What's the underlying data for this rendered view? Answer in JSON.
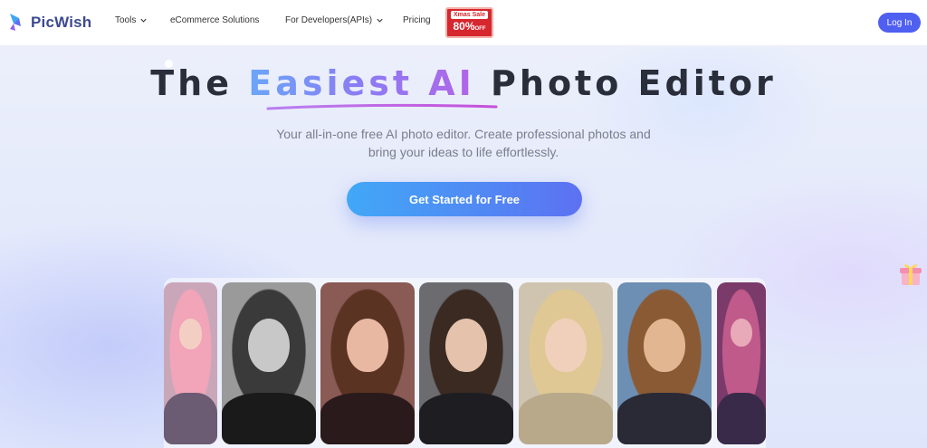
{
  "nav": {
    "logo_text": "PicWish",
    "items": [
      {
        "label": "Tools",
        "has_dropdown": true
      },
      {
        "label": "eCommerce Solutions",
        "has_dropdown": false
      },
      {
        "label": "For Developers(APIs)",
        "has_dropdown": true
      },
      {
        "label": "Pricing",
        "has_dropdown": false
      }
    ],
    "sale_badge": {
      "top": "Xmas Sale",
      "main": "80%",
      "suffix": "OFF"
    },
    "login_label": "Log In"
  },
  "hero": {
    "title_part1": "The ",
    "title_highlight": "Easiest AI",
    "title_part2": " Photo Editor",
    "subtitle_line1": "Your all-in-one free AI photo editor. Create professional photos and",
    "subtitle_line2": "bring your ideas to life effortlessly.",
    "cta_label": "Get Started for Free"
  },
  "colors": {
    "brand": "#4f5ff0",
    "cta_start": "#41a8f7",
    "cta_end": "#5d71f2",
    "sale_red": "#d6262e"
  },
  "gallery": {
    "photos": [
      {
        "name": "pink-hair-headphones-portrait",
        "bg": "#c9a7b9",
        "hair": "#f2a4b8",
        "skin": "#f3cfc3",
        "body": "#6b5b73"
      },
      {
        "name": "monochrome-portrait",
        "bg": "#9a9a9a",
        "hair": "#3a3a3a",
        "skin": "#c8c8c8",
        "body": "#1a1a1a"
      },
      {
        "name": "floral-dress-portrait",
        "bg": "#8a5a55",
        "hair": "#5a3322",
        "skin": "#e8b8a3",
        "body": "#2a1a1c"
      },
      {
        "name": "blazer-portrait",
        "bg": "#6c6c70",
        "hair": "#3a2a22",
        "skin": "#e4c2ab",
        "body": "#1e1e22"
      },
      {
        "name": "blonde-braids-portrait",
        "bg": "#cfc4b0",
        "hair": "#e0c895",
        "skin": "#f0d0bb",
        "body": "#b8a98b"
      },
      {
        "name": "painted-style-portrait",
        "bg": "#6d8fb4",
        "hair": "#8a5a34",
        "skin": "#e2b690",
        "body": "#2a2a36"
      },
      {
        "name": "cyber-headphones-portrait",
        "bg": "#7a3a6a",
        "hair": "#c05a8a",
        "skin": "#e8aab8",
        "body": "#3a2a4a"
      }
    ]
  }
}
